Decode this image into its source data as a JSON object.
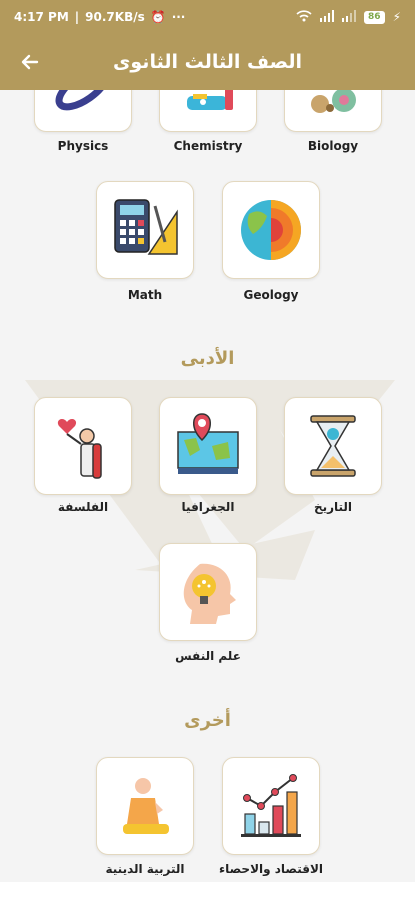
{
  "status": {
    "time": "4:17 PM",
    "speed": "90.7KB/s",
    "dots": "···",
    "battery": "86"
  },
  "appbar": {
    "title": "الصف الثالث الثانوى",
    "back_icon": "arrow-left-icon"
  },
  "sections": {
    "literary": "الأدبى",
    "other": "أخرى"
  },
  "science": [
    {
      "label": "Physics",
      "icon": "physics-icon"
    },
    {
      "label": "Chemistry",
      "icon": "chemistry-icon"
    },
    {
      "label": "Biology",
      "icon": "biology-icon"
    },
    {
      "label": "Math",
      "icon": "math-icon"
    },
    {
      "label": "Geology",
      "icon": "geology-icon"
    }
  ],
  "literary": [
    {
      "label": "الفلسفة",
      "icon": "philosophy-icon"
    },
    {
      "label": "الجغرافيا",
      "icon": "geography-icon"
    },
    {
      "label": "التاريخ",
      "icon": "history-icon"
    },
    {
      "label": "علم النفس",
      "icon": "psychology-icon"
    }
  ],
  "other": [
    {
      "label": "التربية الدينية",
      "icon": "religion-icon"
    },
    {
      "label": "الاقتصاد والاحصاء",
      "icon": "economics-icon"
    }
  ],
  "colors": {
    "primary": "#b39a5c",
    "card_border": "#e3d8bf",
    "background": "#f4f4f4"
  }
}
